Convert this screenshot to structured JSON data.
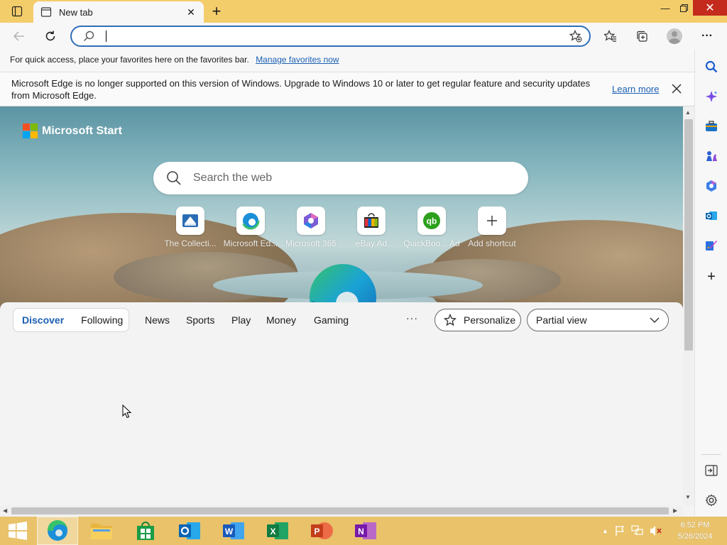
{
  "titlebar": {
    "tab_title": "New tab",
    "accent_color": "#f4cd6b"
  },
  "toolbar": {
    "address_value": "",
    "address_placeholder": ""
  },
  "favorites_bar": {
    "text": "For quick access, place your favorites here on the favorites bar.",
    "link": "Manage favorites now"
  },
  "infobar": {
    "message": "Microsoft Edge is no longer supported on this version of Windows. Upgrade to Windows 10 or later to get regular feature and security updates from Microsoft Edge.",
    "learn_more": "Learn more"
  },
  "start_page": {
    "brand": "Microsoft Start",
    "search_placeholder": "Search the web",
    "shortcuts": [
      {
        "label": "The Collecti...",
        "icon": "book-icon"
      },
      {
        "label": "Microsoft Ed...",
        "icon": "edge-icon"
      },
      {
        "label": "Microsoft 365",
        "icon": "m365-icon"
      },
      {
        "label": "eBay Ad",
        "icon": "ebay-icon"
      },
      {
        "label": "QuickBoo... Ad",
        "icon": "quickbooks-icon"
      },
      {
        "label": "Add shortcut",
        "icon": "plus-icon"
      }
    ]
  },
  "feed": {
    "toggle": [
      "Discover",
      "Following"
    ],
    "tabs": [
      "News",
      "Sports",
      "Play",
      "Money",
      "Gaming"
    ],
    "more": "···",
    "personalize": "Personalize",
    "view": "Partial view"
  },
  "taskbar": {
    "apps": [
      "edge",
      "file-explorer",
      "store",
      "outlook",
      "word",
      "excel",
      "powerpoint",
      "onenote"
    ],
    "time": "6:52 PM",
    "date": "5/26/2024"
  }
}
